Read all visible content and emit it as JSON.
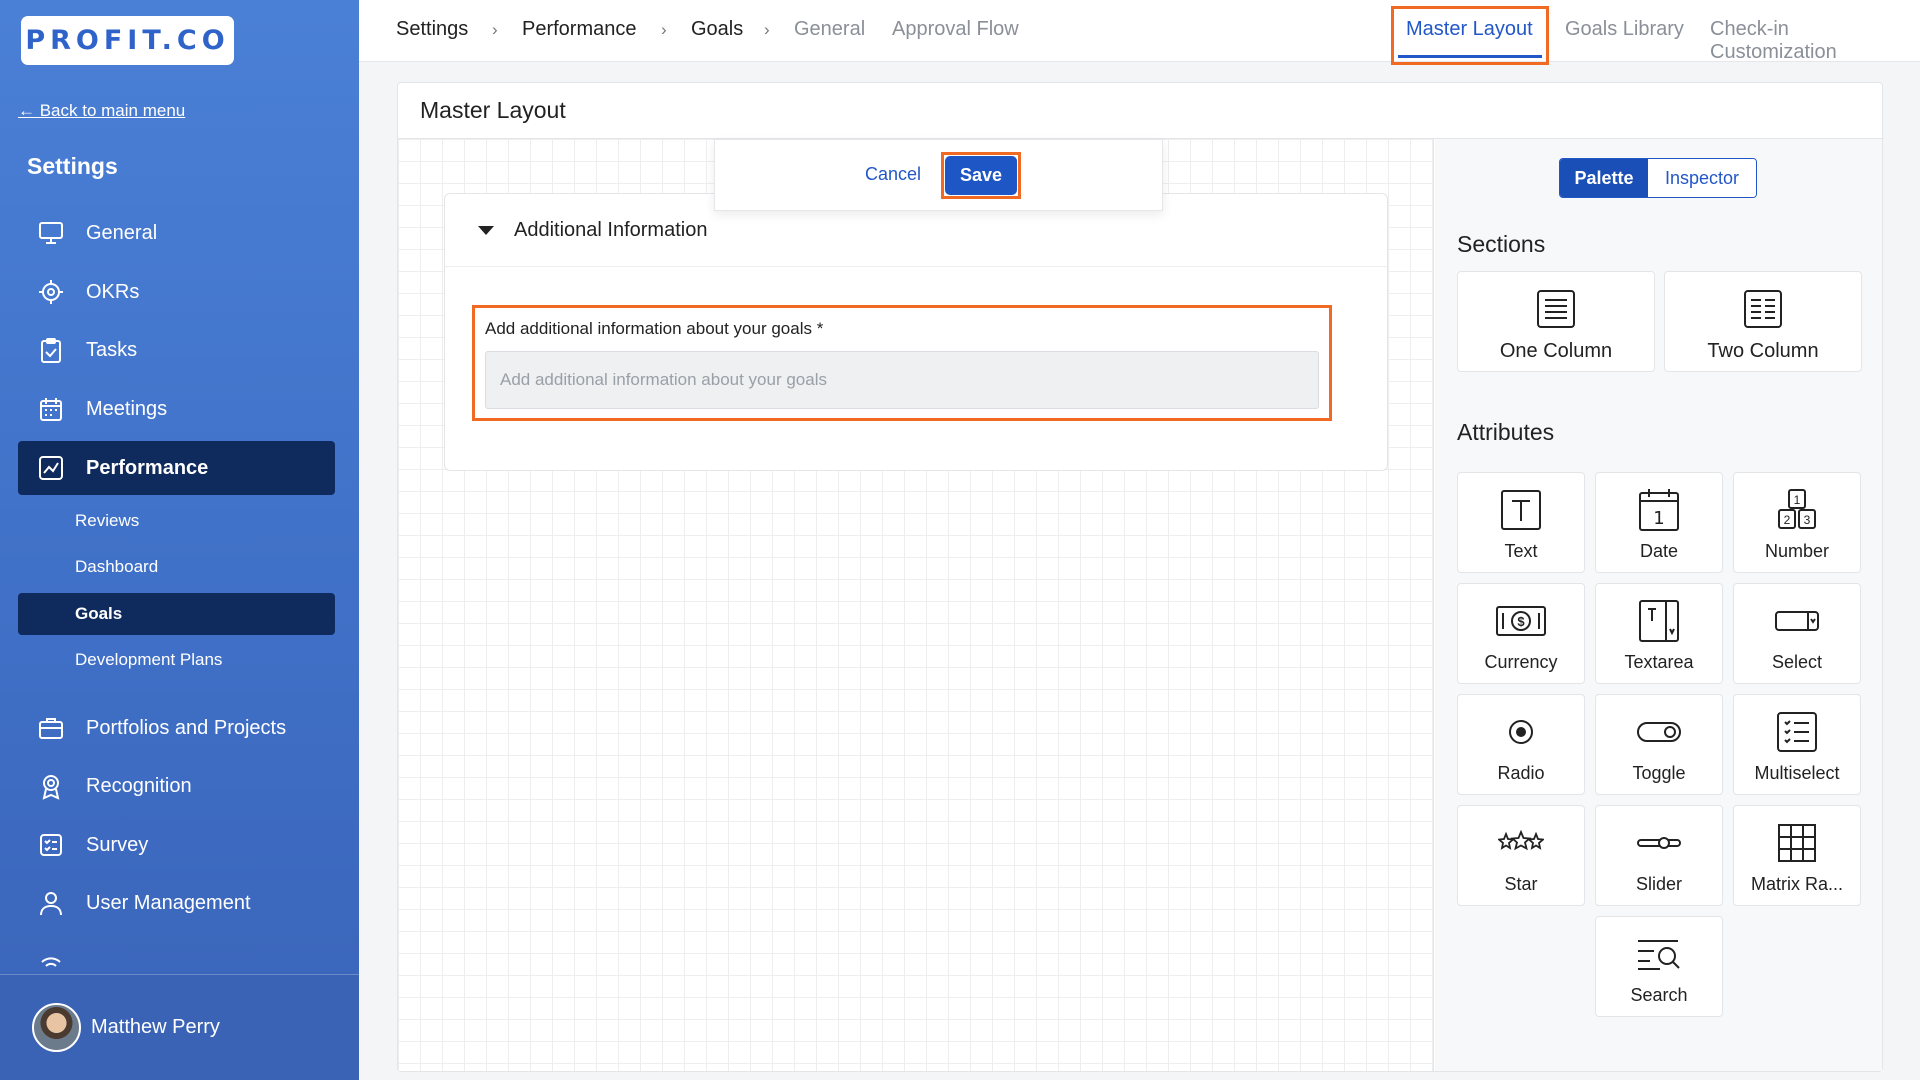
{
  "brand": {
    "logo_text": "PROFIT.CO"
  },
  "sidebar": {
    "back_link": "← Back to main menu",
    "title": "Settings",
    "items": [
      {
        "label": "General",
        "icon": "monitor-icon"
      },
      {
        "label": "OKRs",
        "icon": "target-icon"
      },
      {
        "label": "Tasks",
        "icon": "clipboard-check-icon"
      },
      {
        "label": "Meetings",
        "icon": "calendar-icon"
      },
      {
        "label": "Performance",
        "icon": "chart-line-icon"
      },
      {
        "label": "Portfolios and Projects",
        "icon": "briefcase-icon"
      },
      {
        "label": "Recognition",
        "icon": "award-icon"
      },
      {
        "label": "Survey",
        "icon": "survey-list-icon"
      },
      {
        "label": "User Management",
        "icon": "user-icon"
      }
    ],
    "sub_items": [
      "Reviews",
      "Dashboard",
      "Goals",
      "Development Plans"
    ],
    "user": {
      "name": "Matthew Perry"
    }
  },
  "breadcrumb": {
    "items": [
      "Settings",
      "Performance",
      "Goals"
    ],
    "tabs": [
      "General",
      "Approval Flow",
      "Master Layout",
      "Goals Library",
      "Check-in Customization"
    ],
    "active_tab": "Master Layout"
  },
  "card": {
    "title": "Master Layout"
  },
  "toolbar": {
    "cancel_label": "Cancel",
    "save_label": "Save"
  },
  "section": {
    "title": "Additional Information",
    "field_label": "Add additional information about your goals *",
    "field_placeholder": "Add additional information about your goals",
    "field_value": ""
  },
  "palette": {
    "toggle_palette": "Palette",
    "toggle_inspector": "Inspector",
    "sections_heading": "Sections",
    "sections": [
      "One Column",
      "Two Column"
    ],
    "attributes_heading": "Attributes",
    "attributes": [
      "Text",
      "Date",
      "Number",
      "Currency",
      "Textarea",
      "Select",
      "Radio",
      "Toggle",
      "Multiselect",
      "Star",
      "Slider",
      "Matrix Ra...",
      "Search"
    ]
  },
  "colors": {
    "accent": "#2257c7",
    "highlight": "#f06a23",
    "sidebar": "#4a80d6",
    "active_nav": "#0f2a5c"
  }
}
